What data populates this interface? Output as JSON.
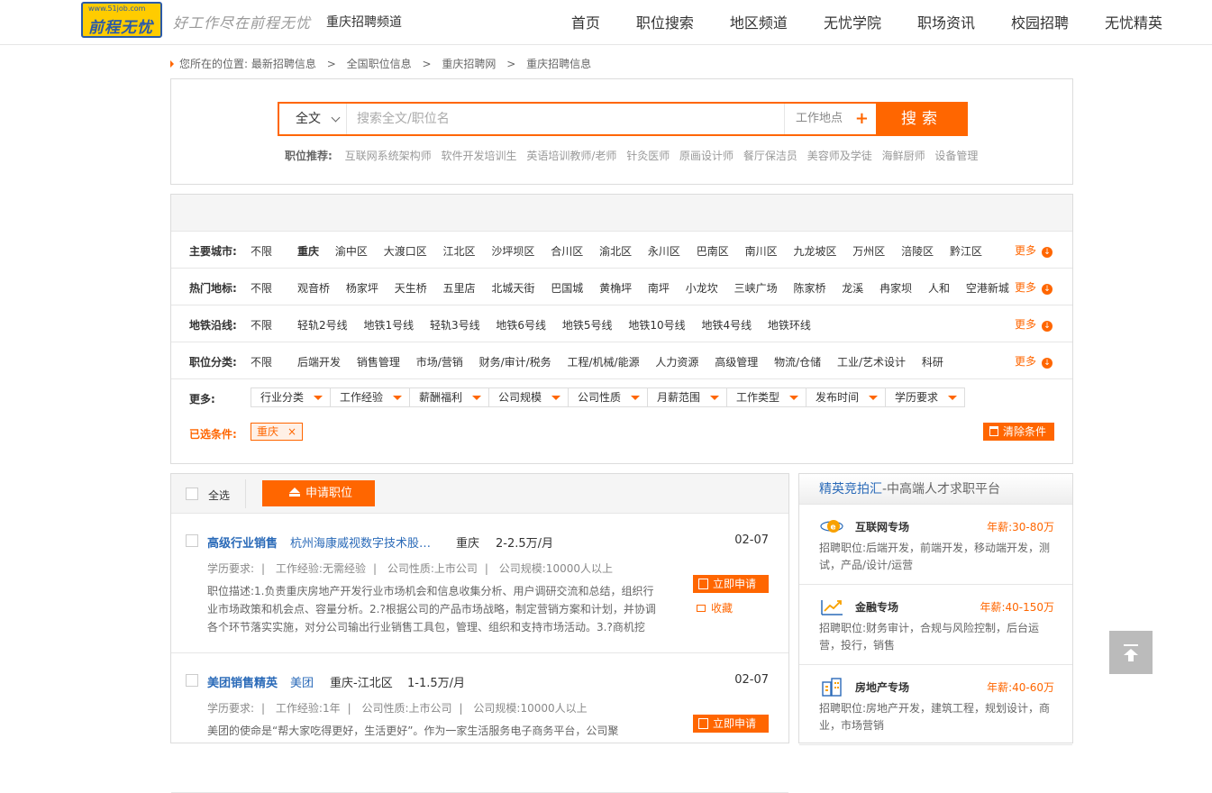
{
  "header": {
    "logo_url": "www.51job.com",
    "logo_brand": "前程无忧",
    "slogan": "好工作尽在前程无忧",
    "channel": "重庆招聘频道",
    "nav": [
      "首页",
      "职位搜索",
      "地区频道",
      "无忧学院",
      "职场资讯",
      "校园招聘",
      "无忧精英"
    ]
  },
  "breadcrumb": {
    "prefix": "您所在的位置:",
    "items": [
      "最新招聘信息",
      "全国职位信息",
      "重庆招聘网",
      "重庆招聘信息"
    ],
    "separator": ">"
  },
  "search": {
    "type": "全文",
    "placeholder": "搜索全文/职位名",
    "location": "工作地点",
    "button": "搜索",
    "recommend_label": "职位推荐:",
    "recommend": [
      "互联网系统架构师",
      "软件开发培训生",
      "英语培训教师/老师",
      "针灸医师",
      "原画设计师",
      "餐厅保洁员",
      "美容师及学徒",
      "海鲜厨师",
      "设备管理"
    ]
  },
  "filters": {
    "more_label": "更多",
    "rows": [
      {
        "label": "主要城市:",
        "all": "不限",
        "items": [
          "重庆",
          "渝中区",
          "大渡口区",
          "江北区",
          "沙坪坝区",
          "合川区",
          "渝北区",
          "永川区",
          "巴南区",
          "南川区",
          "九龙坡区",
          "万州区",
          "涪陵区",
          "黔江区"
        ]
      },
      {
        "label": "热门地标:",
        "all": "不限",
        "items": [
          "观音桥",
          "杨家坪",
          "天生桥",
          "五里店",
          "北城天街",
          "巴国城",
          "黄桷坪",
          "南坪",
          "小龙坎",
          "三峡广场",
          "陈家桥",
          "龙溪",
          "冉家坝",
          "人和",
          "空港新城"
        ]
      },
      {
        "label": "地铁沿线:",
        "all": "不限",
        "items": [
          "轻轨2号线",
          "地铁1号线",
          "轻轨3号线",
          "地铁6号线",
          "地铁5号线",
          "地铁10号线",
          "地铁4号线",
          "地铁环线"
        ]
      },
      {
        "label": "职位分类:",
        "all": "不限",
        "items": [
          "后端开发",
          "销售管理",
          "市场/营销",
          "财务/审计/税务",
          "工程/机械/能源",
          "人力资源",
          "高级管理",
          "物流/仓储",
          "工业/艺术设计",
          "科研"
        ]
      }
    ],
    "extra_label": "更多:",
    "dropdowns": [
      "行业分类",
      "工作经验",
      "薪酬福利",
      "公司规模",
      "公司性质",
      "月薪范围",
      "工作类型",
      "发布时间",
      "学历要求"
    ],
    "selected_label": "已选条件:",
    "selected_tag": "重庆",
    "tag_close": "×",
    "clear": "清除条件"
  },
  "list": {
    "select_all": "全选",
    "apply_button": "申请职位",
    "jobs": [
      {
        "title": "高级行业销售",
        "company": "杭州海康威视数字技术股份...",
        "city": "重庆",
        "salary": "2-2.5万/月",
        "date": "02-07",
        "info": [
          "学历要求:",
          "工作经验:无需经验",
          "公司性质:上市公司",
          "公司规模:10000人以上"
        ],
        "desc": "职位描述:1.负责重庆房地产开发行业市场机会和信息收集分析、用户调研交流和总结，组织行业市场政策和机会点、容量分析。2.?根据公司的产品市场战略，制定营销方案和计划，并协调各个环节落实实施，对分公司输出行业销售工具包，管理、组织和支持市场活动。3.?商机挖",
        "apply": "立即申请",
        "fav": "收藏"
      },
      {
        "title": "美团销售精英",
        "company": "美团",
        "city": "重庆-江北区",
        "salary": "1-1.5万/月",
        "date": "02-07",
        "info": [
          "学历要求:",
          "工作经验:1年",
          "公司性质:上市公司",
          "公司规模:10000人以上"
        ],
        "desc": "美团的使命是“帮大家吃得更好，生活更好”。作为一家生活服务电子商务平台，公司聚",
        "apply": "立即申请",
        "fav": "收藏"
      }
    ]
  },
  "sidebar": {
    "title_blue": "精英竞拍汇",
    "title_rest": "-中高端人才求职平台",
    "zones": [
      {
        "name": "互联网专场",
        "salary": "年薪:30-80万",
        "jobs": "招聘职位:后端开发，前端开发，移动端开发，测试，产品/设计/运营"
      },
      {
        "name": "金融专场",
        "salary": "年薪:40-150万",
        "jobs": "招聘职位:财务审计，合规与风险控制，后台运营，投行，销售"
      },
      {
        "name": "房地产专场",
        "salary": "年薪:40-60万",
        "jobs": "招聘职位:房地产开发，建筑工程，规划设计，商业，市场营销"
      }
    ]
  },
  "colors": {
    "accent": "#ff6600",
    "link": "#2a6ab8",
    "logo_bg": "#ffcc00"
  }
}
